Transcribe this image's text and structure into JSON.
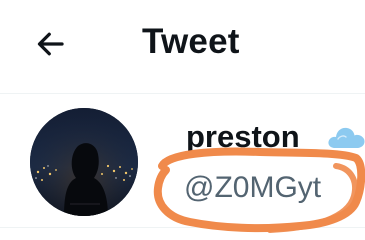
{
  "header": {
    "back_icon": "arrow-left-icon",
    "title": "Tweet"
  },
  "tweet": {
    "author": {
      "display_name": "preston",
      "handle": "@Z0MGyt",
      "avatar_icon": "avatar-photo",
      "badge_icon": "cloud-icon"
    }
  },
  "colors": {
    "text_primary": "#0f1419",
    "text_secondary": "#536471",
    "divider": "#eff3f4",
    "annotation": "#f08a4b",
    "badge": "#8ccaf0"
  }
}
